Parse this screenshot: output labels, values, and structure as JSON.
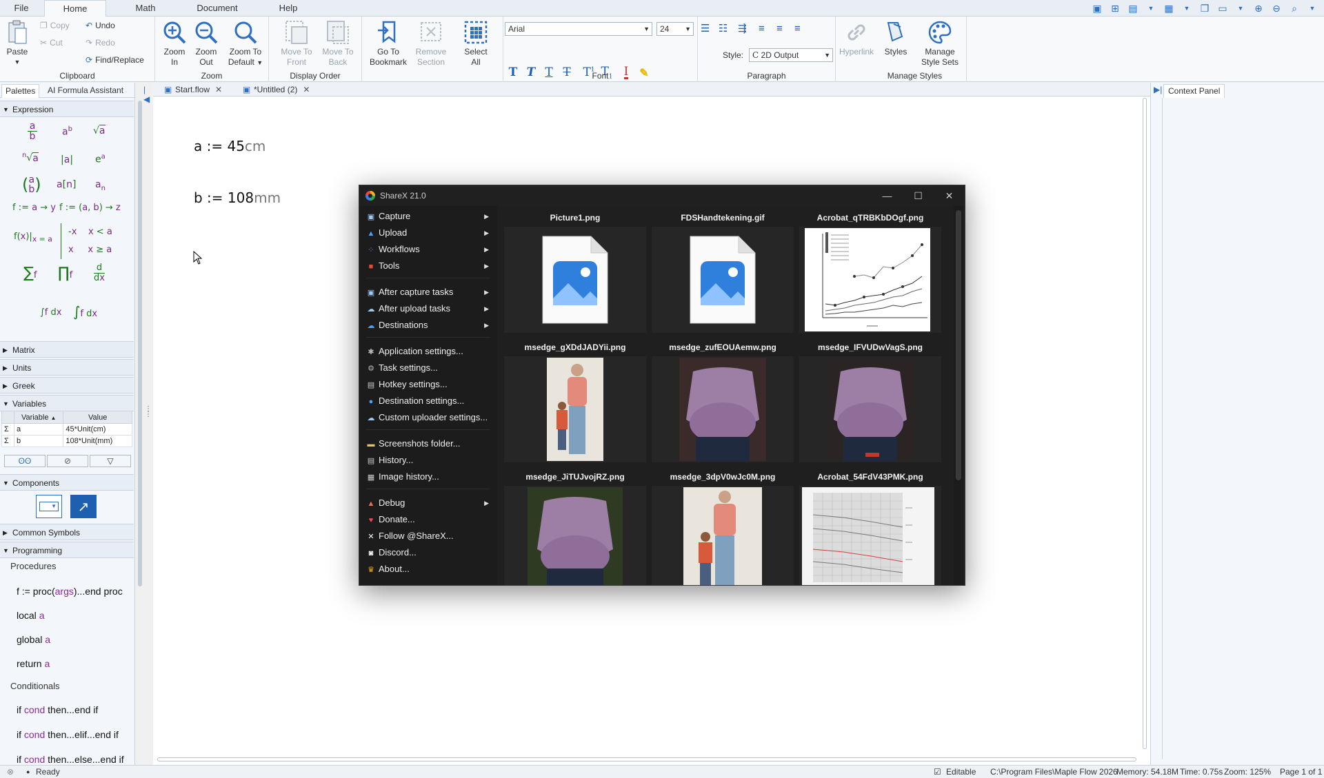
{
  "menu_tabs": [
    {
      "label": "File"
    },
    {
      "label": "Home"
    },
    {
      "label": "Math"
    },
    {
      "label": "Document"
    },
    {
      "label": "Help"
    }
  ],
  "ribbon": {
    "clipboard": {
      "group_label": "Clipboard",
      "paste": "Paste",
      "copy": "Copy",
      "cut": "Cut",
      "undo": "Undo",
      "redo": "Redo",
      "find_replace": "Find/Replace"
    },
    "zoom": {
      "group_label": "Zoom",
      "zoom_in": [
        "Zoom",
        "In"
      ],
      "zoom_out": [
        "Zoom",
        "Out"
      ],
      "zoom_default": [
        "Zoom To",
        "Default"
      ]
    },
    "display_order": {
      "group_label": "Display Order",
      "move_front": [
        "Move To",
        "Front"
      ],
      "move_back": [
        "Move To",
        "Back"
      ]
    },
    "bookmark": {
      "goto": [
        "Go To",
        "Bookmark"
      ],
      "remove_section": [
        "Remove",
        "Section"
      ],
      "select_all": [
        "Select",
        "All"
      ]
    },
    "font": {
      "group_label": "Font",
      "family": "Arial",
      "size": "24"
    },
    "paragraph": {
      "group_label": "Paragraph",
      "style_label": "Style:",
      "style_value": "2D Output"
    },
    "styles": {
      "group_label": "Manage Styles",
      "hyperlink": "Hyperlink",
      "styles": "Styles",
      "manage_style_sets": [
        "Manage",
        "Style Sets"
      ]
    }
  },
  "left_panel": {
    "tabs": [
      "Palettes",
      "AI Formula Assistant"
    ],
    "sections": {
      "expression": "Expression",
      "matrix": "Matrix",
      "units": "Units",
      "greek": "Greek",
      "variables": "Variables",
      "components": "Components",
      "common_symbols": "Common Symbols",
      "programming": "Programming"
    },
    "variables_table": {
      "headers": [
        "Variable",
        "Value"
      ],
      "rows": [
        {
          "symbol": "Σ",
          "name": "a",
          "value": "45*Unit(cm)"
        },
        {
          "symbol": "Σ",
          "name": "b",
          "value": "108*Unit(mm)"
        }
      ]
    },
    "programming": {
      "procedures_label": "Procedures",
      "proc": {
        "pre": "f := proc(",
        "args": "args",
        "post": ")...end proc"
      },
      "local": {
        "kw": "local ",
        "var": "a"
      },
      "global": {
        "kw": "global ",
        "var": "a"
      },
      "return": {
        "kw": "return ",
        "var": "a"
      },
      "conditionals_label": "Conditionals",
      "if1": {
        "pre": "if ",
        "cond": "cond",
        "post": " then...end if"
      },
      "if2": {
        "pre": "if ",
        "cond": "cond",
        "post": " then...elif...end if"
      },
      "if3": {
        "pre": "if ",
        "cond": "cond",
        "post": " then...else...end if"
      }
    }
  },
  "document": {
    "tabs": [
      {
        "label": "Start.flow"
      },
      {
        "label": "*Untitled (2)"
      }
    ],
    "lines": [
      {
        "lhs": "a := 45",
        "unit": "cm"
      },
      {
        "lhs": "b := 108",
        "unit": "mm"
      }
    ]
  },
  "right_panel": {
    "tab": "Context Panel"
  },
  "status_bar": {
    "ready": "Ready",
    "editable": "Editable",
    "path": "C:\\Program Files\\Maple Flow 2026",
    "memory": "Memory: 54.18M",
    "time": "Time: 0.75s",
    "zoom": "Zoom: 125%",
    "page": "Page 1 of 1"
  },
  "sharex": {
    "title": "ShareX 21.0",
    "menu": [
      {
        "label": "Capture",
        "icon": "camera-icon",
        "sub": true
      },
      {
        "label": "Upload",
        "icon": "upload-icon",
        "sub": true
      },
      {
        "label": "Workflows",
        "icon": "workflows-icon",
        "sub": true
      },
      {
        "label": "Tools",
        "icon": "toolbox-icon",
        "sub": true
      },
      {
        "label": "After capture tasks",
        "icon": "after-capture-icon",
        "sub": true
      },
      {
        "label": "After upload tasks",
        "icon": "after-upload-icon",
        "sub": true
      },
      {
        "label": "Destinations",
        "icon": "cloud-icon",
        "sub": true
      },
      {
        "label": "Application settings...",
        "icon": "wrench-icon",
        "sub": false
      },
      {
        "label": "Task settings...",
        "icon": "gear-icon",
        "sub": false
      },
      {
        "label": "Hotkey settings...",
        "icon": "keyboard-icon",
        "sub": false
      },
      {
        "label": "Destination settings...",
        "icon": "globe-icon",
        "sub": false
      },
      {
        "label": "Custom uploader settings...",
        "icon": "uploader-icon",
        "sub": false
      },
      {
        "label": "Screenshots folder...",
        "icon": "folder-icon",
        "sub": false
      },
      {
        "label": "History...",
        "icon": "history-icon",
        "sub": false
      },
      {
        "label": "Image history...",
        "icon": "image-history-icon",
        "sub": false
      },
      {
        "label": "Debug",
        "icon": "bug-icon",
        "sub": true
      },
      {
        "label": "Donate...",
        "icon": "heart-icon",
        "sub": false
      },
      {
        "label": "Follow @ShareX...",
        "icon": "x-logo-icon",
        "sub": false
      },
      {
        "label": "Discord...",
        "icon": "discord-icon",
        "sub": false
      },
      {
        "label": "About...",
        "icon": "crown-icon",
        "sub": false
      }
    ],
    "thumbnails": [
      {
        "name": "Picture1.png",
        "kind": "file-icon"
      },
      {
        "name": "FDSHandtekening.gif",
        "kind": "file-icon"
      },
      {
        "name": "Acrobat_qTRBKbDOgf.png",
        "kind": "line-chart"
      },
      {
        "name": "msedge_gXDdJADYii.png",
        "kind": "photo-tall"
      },
      {
        "name": "msedge_zufEOUAemw.png",
        "kind": "photo-belly"
      },
      {
        "name": "msedge_IFVUDwVagS.png",
        "kind": "photo-belly"
      },
      {
        "name": "msedge_JiTUJvojRZ.png",
        "kind": "photo-belly"
      },
      {
        "name": "msedge_3dpV0wJc0M.png",
        "kind": "photo-tall"
      },
      {
        "name": "Acrobat_54FdV43PMK.png",
        "kind": "grid-chart"
      }
    ]
  }
}
